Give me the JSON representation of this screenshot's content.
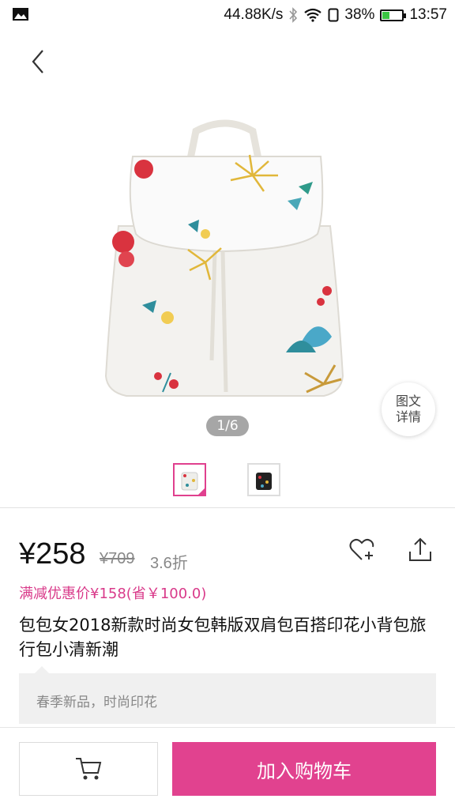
{
  "status_bar": {
    "speed": "44.88K/s",
    "battery_percent": "38%",
    "battery_level": 0.38,
    "time": "13:57"
  },
  "gallery": {
    "page_indicator": "1/6",
    "detail_button_label": "图文\n详情",
    "thumbnails": [
      {
        "name": "white-floral-backpack",
        "active": true
      },
      {
        "name": "black-floral-backpack",
        "active": false
      }
    ]
  },
  "product": {
    "price": "¥258",
    "original_price": "¥709",
    "discount": "3.6折",
    "promo": "满减优惠价¥158(省￥100.0)",
    "title": "包包女2018新款时尚女包韩版双肩包百搭印花小背包旅行包小清新潮",
    "description": "春季新品，时尚印花"
  },
  "actions": {
    "add_to_cart_label": "加入购物车"
  },
  "colors": {
    "accent": "#e1428f",
    "promo": "#d93a8a",
    "battery_fill": "#3ac442"
  },
  "icons": [
    "image-icon",
    "bluetooth-icon",
    "wifi-icon",
    "battery-icon",
    "back-icon",
    "heart-plus-icon",
    "share-icon",
    "cart-icon"
  ]
}
